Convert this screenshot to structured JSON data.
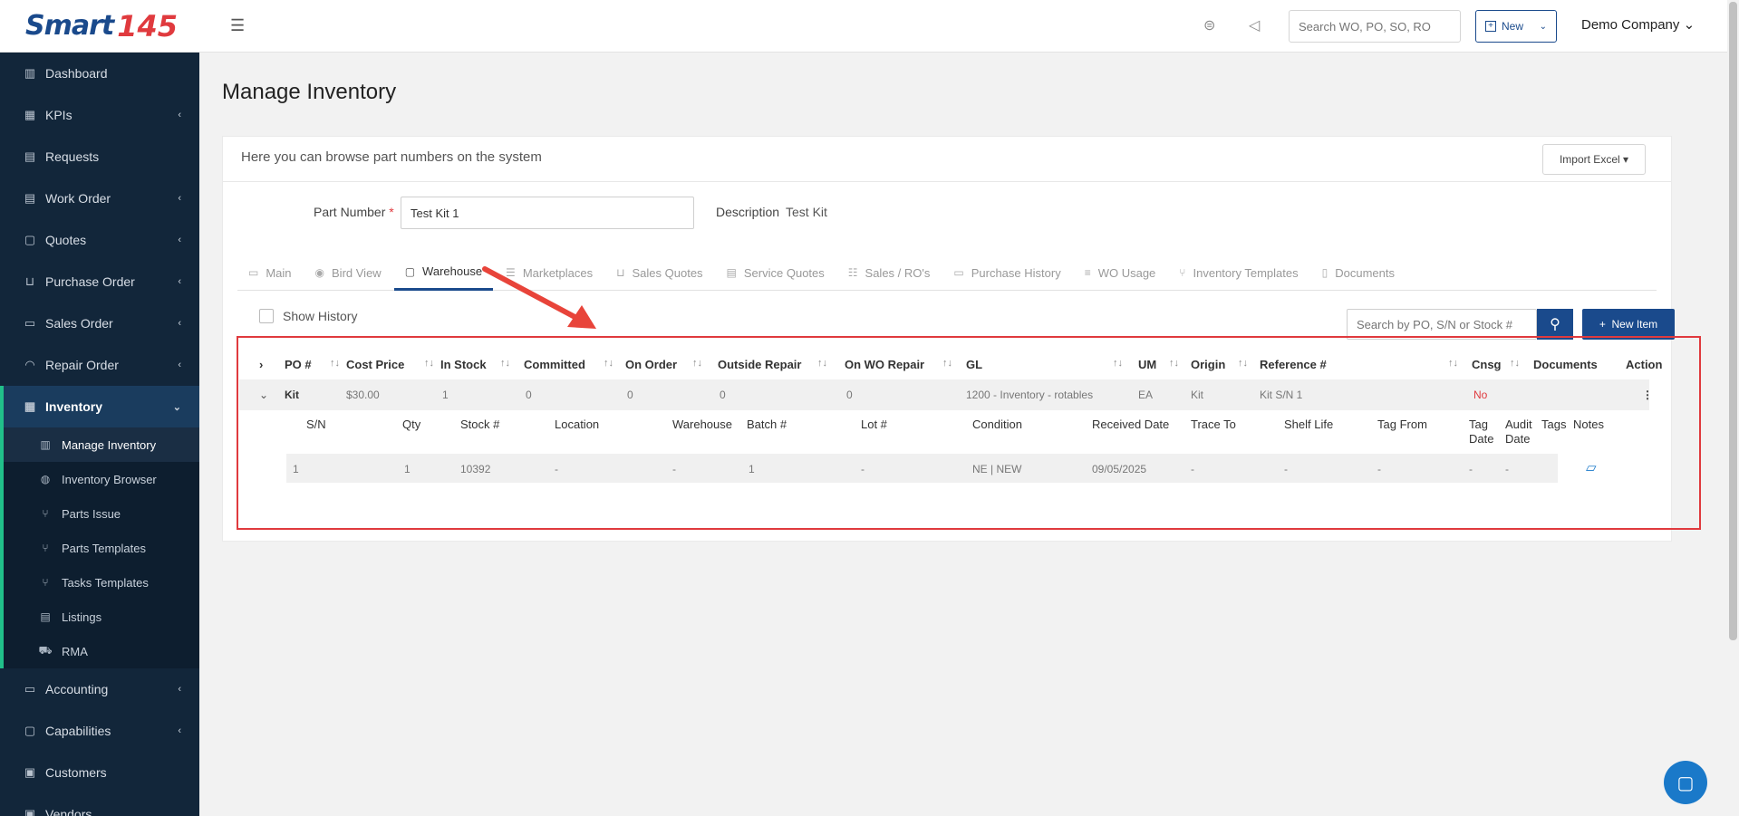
{
  "logo": {
    "text": "Smart",
    "num": "145"
  },
  "sidebar": {
    "items": [
      {
        "label": "Dashboard",
        "icon": "chart-icon"
      },
      {
        "label": "KPIs",
        "icon": "kpi-icon",
        "chev": "‹"
      },
      {
        "label": "Requests",
        "icon": "request-icon"
      },
      {
        "label": "Work Order",
        "icon": "work-order-icon",
        "chev": "‹"
      },
      {
        "label": "Quotes",
        "icon": "quote-icon",
        "chev": "‹"
      },
      {
        "label": "Purchase Order",
        "icon": "cart-icon",
        "chev": "‹"
      },
      {
        "label": "Sales Order",
        "icon": "sales-icon",
        "chev": "‹"
      },
      {
        "label": "Repair Order",
        "icon": "repair-icon",
        "chev": "‹"
      },
      {
        "label": "Inventory",
        "icon": "inventory-icon",
        "chev": "⌄"
      }
    ],
    "sub": [
      {
        "label": "Manage Inventory"
      },
      {
        "label": "Inventory Browser"
      },
      {
        "label": "Parts Issue"
      },
      {
        "label": "Parts Templates"
      },
      {
        "label": "Tasks Templates"
      },
      {
        "label": "Listings"
      },
      {
        "label": "RMA"
      }
    ],
    "after": [
      {
        "label": "Accounting",
        "chev": "‹"
      },
      {
        "label": "Capabilities",
        "chev": "‹"
      },
      {
        "label": "Customers"
      },
      {
        "label": "Vendors"
      }
    ]
  },
  "topbar": {
    "search_placeholder": "Search WO, PO, SO, RO",
    "new_label": "New",
    "company": "Demo Company"
  },
  "page": {
    "title": "Manage Inventory",
    "subtitle": "Here you can browse part numbers on the system",
    "import_label": "Import Excel",
    "part_label": "Part Number",
    "part_value": "Test Kit 1",
    "desc_label": "Description",
    "desc_value": "Test Kit"
  },
  "tabs": [
    "Main",
    "Bird View",
    "Warehouse",
    "Marketplaces",
    "Sales Quotes",
    "Service Quotes",
    "Sales / RO's",
    "Purchase History",
    "WO Usage",
    "Inventory Templates",
    "Documents"
  ],
  "toolbar": {
    "history_label": "Show History",
    "search_placeholder": "Search by PO, S/N or Stock #",
    "new_item_label": "New Item"
  },
  "table": {
    "headers": [
      "PO #",
      "Cost Price",
      "In Stock",
      "Committed",
      "On Order",
      "Outside Repair",
      "On WO Repair",
      "GL",
      "UM",
      "Origin",
      "Reference #",
      "Cnsg",
      "Documents",
      "Action"
    ],
    "row": [
      "Kit",
      "$30.00",
      "1",
      "0",
      "0",
      "0",
      "0",
      "1200 - Inventory - rotables",
      "EA",
      "Kit",
      "Kit S/N 1",
      "No"
    ],
    "sub_headers": [
      "S/N",
      "Qty",
      "Stock #",
      "Location",
      "Warehouse",
      "Batch #",
      "Lot #",
      "Condition",
      "Received Date",
      "Trace To",
      "Shelf Life",
      "Tag From",
      "Tag Date",
      "Audit Date",
      "Tags",
      "Notes"
    ],
    "sub_row": [
      "1",
      "1",
      "10392",
      "-",
      "-",
      "1",
      "-",
      "NE | NEW",
      "09/05/2025",
      "-",
      "-",
      "-",
      "-",
      "-"
    ]
  }
}
